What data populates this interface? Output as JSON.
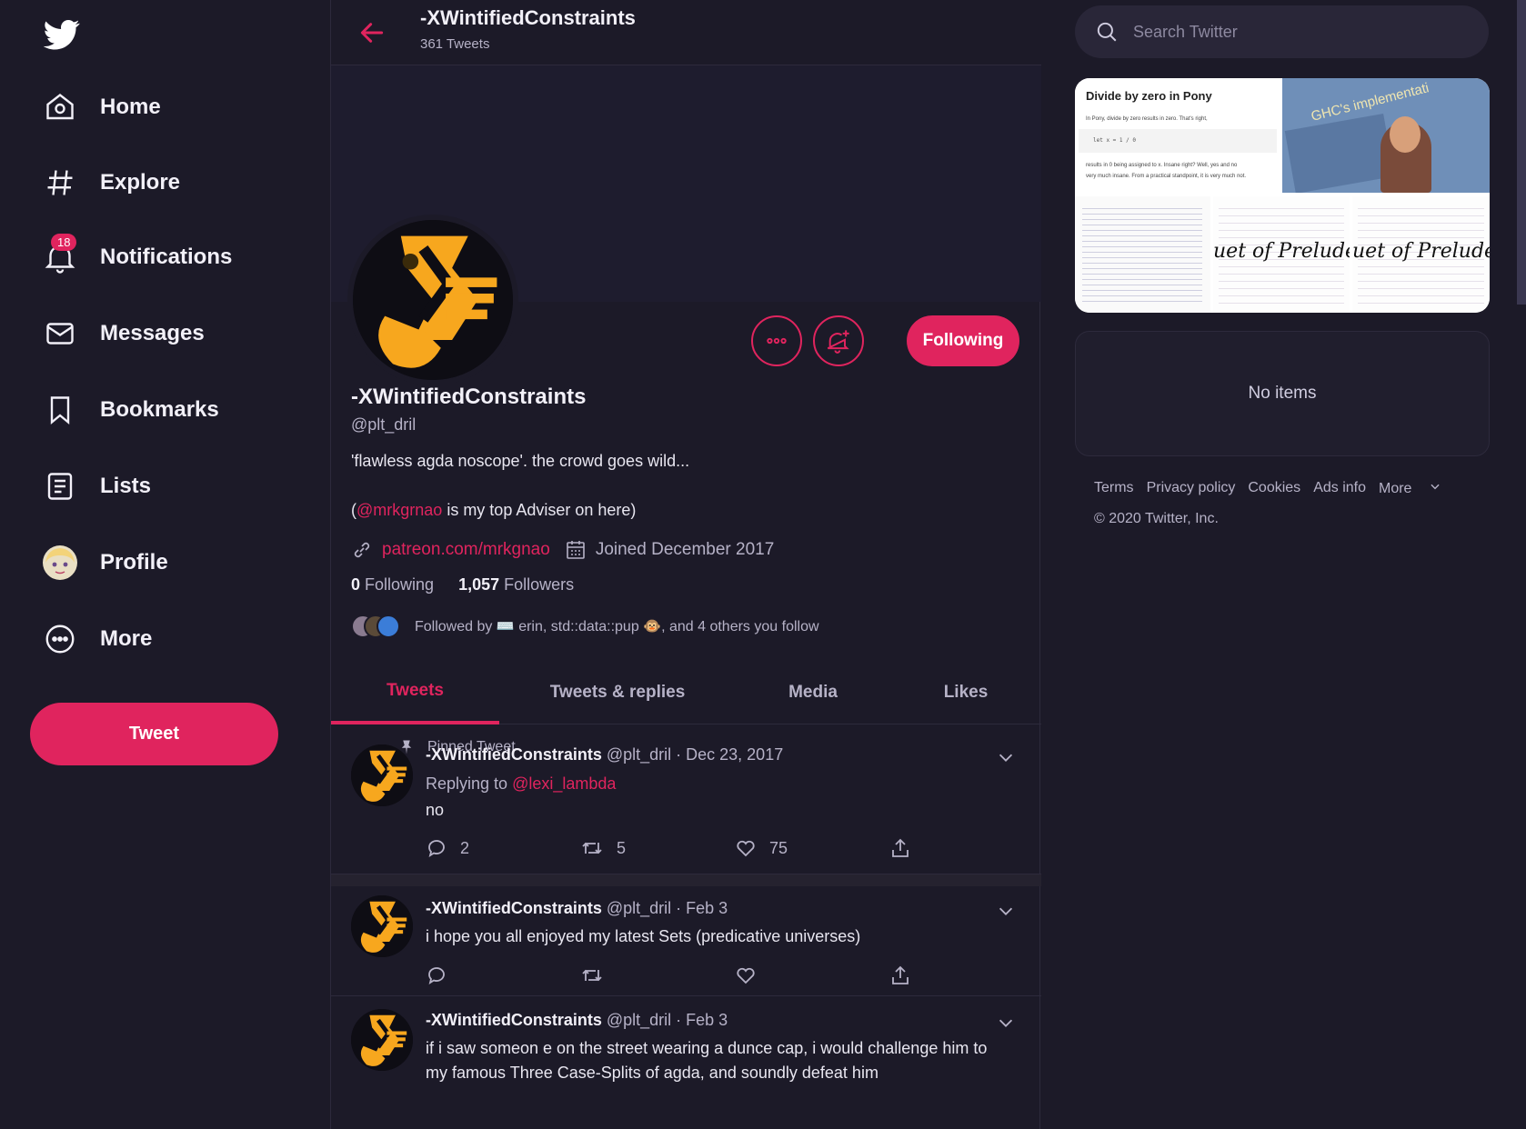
{
  "sidebar": {
    "items": [
      {
        "label": "Home",
        "icon": "home-icon"
      },
      {
        "label": "Explore",
        "icon": "hashtag-icon"
      },
      {
        "label": "Notifications",
        "icon": "bell-icon",
        "badge": "18"
      },
      {
        "label": "Messages",
        "icon": "envelope-icon"
      },
      {
        "label": "Bookmarks",
        "icon": "bookmark-icon"
      },
      {
        "label": "Lists",
        "icon": "list-icon"
      },
      {
        "label": "Profile",
        "icon": "avatar"
      },
      {
        "label": "More",
        "icon": "more-circle-icon"
      }
    ],
    "tweet_label": "Tweet"
  },
  "header": {
    "title": "-XWintifiedConstraints",
    "tweet_count": "361 Tweets"
  },
  "profile": {
    "name": "-XWintifiedConstraints",
    "handle": "@plt_dril",
    "bio_line1": "'flawless agda noscope'. the crowd goes wild...",
    "bio_open": "(",
    "bio_mention": "@mrkgrnao",
    "bio_rest": " is my top Adviser on here)",
    "website": "patreon.com/mrkgnao",
    "joined": "Joined December 2017",
    "following_count": "0",
    "following_label": "Following",
    "followers_count": "1,057",
    "followers_label": "Followers",
    "followed_by": "Followed by ⌨️ erin, std::data::pup 🐵, and 4 others you follow",
    "following_button": "Following"
  },
  "tabs": [
    {
      "label": "Tweets",
      "active": true
    },
    {
      "label": "Tweets & replies",
      "active": false
    },
    {
      "label": "Media",
      "active": false
    },
    {
      "label": "Likes",
      "active": false
    }
  ],
  "tweets": [
    {
      "pinned_label": "Pinned Tweet",
      "name": "-XWintifiedConstraints",
      "meta": " @plt_dril · Dec 23, 2017",
      "reply_prefix": "Replying to ",
      "reply_to": "@lexi_lambda",
      "text": "no",
      "replies": "2",
      "retweets": "5",
      "likes": "75"
    },
    {
      "name": "-XWintifiedConstraints",
      "meta": " @plt_dril · Feb 3",
      "text": "i hope you all enjoyed my latest Sets (predicative universes)"
    },
    {
      "name": "-XWintifiedConstraints",
      "meta": " @plt_dril · Feb 3",
      "text": "if i saw someon e on the street wearing a dunce cap, i would challenge him to my famous Three Case-Splits of agda, and soundly defeat him"
    }
  ],
  "right": {
    "search_placeholder": "Search Twitter",
    "media": {
      "img1_title": "Divide by zero in Pony",
      "img1_line1": "In Pony, divide by zero results in zero. That's right,",
      "img1_code": "let x = 1 / 0",
      "img1_line2": "results in 0 being assigned to x. Insane right? Well, yes and no",
      "img1_line3": "very much insane. From a practical standpoint, it is very much not.",
      "img2_text": "GHC's implementati",
      "img4_text": "uet of Preludes",
      "img5_text": "uet of Preludes"
    },
    "no_items": "No items",
    "footer_links": [
      "Terms",
      "Privacy policy",
      "Cookies",
      "Ads info",
      "More"
    ],
    "copyright": "© 2020 Twitter, Inc."
  },
  "colors": {
    "accent": "#e0245e",
    "background": "#1c1a28",
    "text_secondary": "#b6b2c7"
  }
}
